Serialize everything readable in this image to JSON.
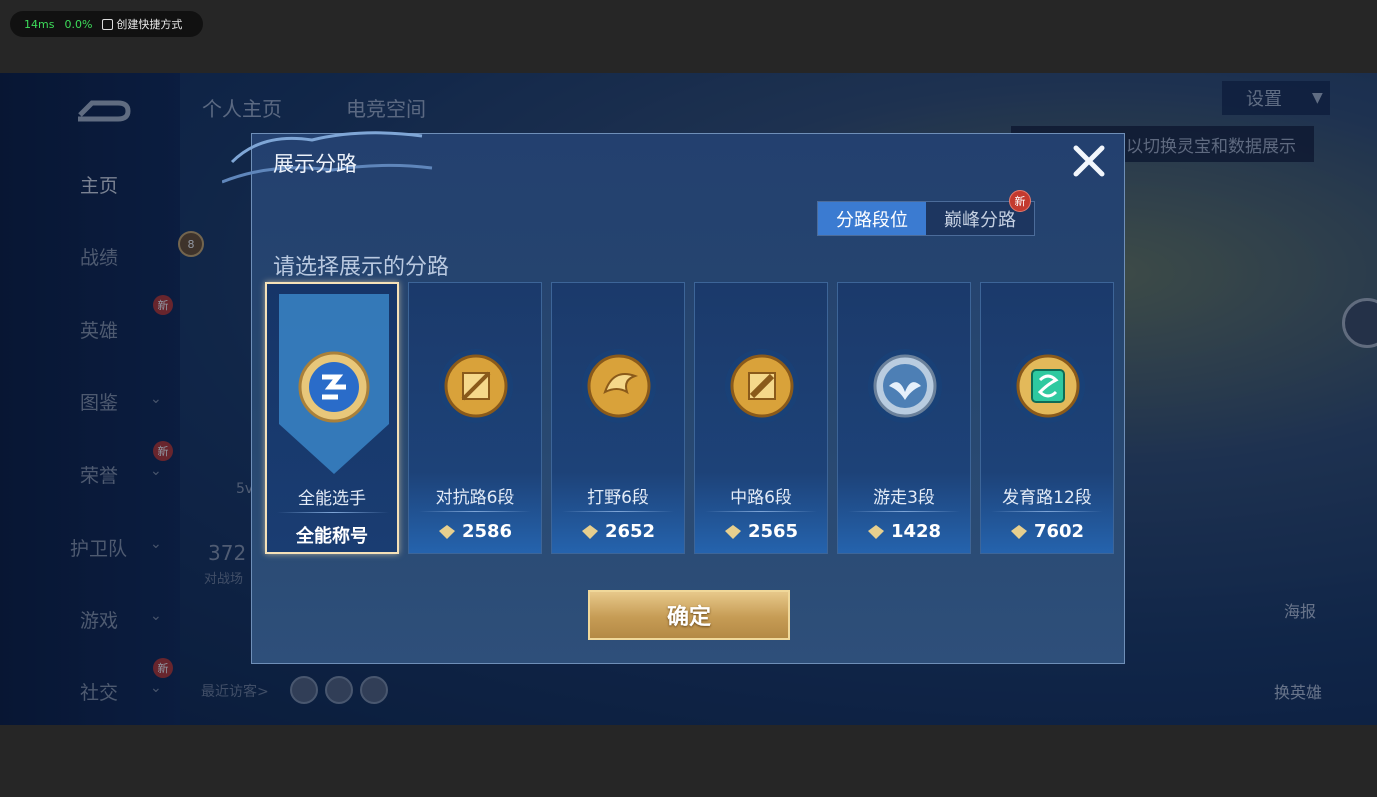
{
  "perf": {
    "ms": "14ms",
    "pct": "0.0%",
    "shortcut": "创建快捷方式"
  },
  "background": {
    "tabs": [
      "个人主页",
      "电竞空间"
    ],
    "sidebar": [
      {
        "label": "主页",
        "active": true
      },
      {
        "label": "战绩"
      },
      {
        "label": "英雄"
      },
      {
        "label": "图鉴"
      },
      {
        "label": "荣誉"
      },
      {
        "label": "护卫队"
      },
      {
        "label": "游戏"
      },
      {
        "label": "社交"
      }
    ],
    "new_badge": "新",
    "settings": "设置",
    "hint": "以切换灵宝和数据展示",
    "right_labels": [
      "海报",
      "换英雄"
    ],
    "visitors": "最近访客>",
    "stat_value": "372",
    "stat_label": "对战场",
    "level_badge": "8",
    "fivev": "5v"
  },
  "modal": {
    "title": "展示分路",
    "segments": [
      {
        "label": "分路段位",
        "active": true
      },
      {
        "label": "巅峰分路",
        "new": "新"
      }
    ],
    "subtitle": "请选择展示的分路",
    "cards": [
      {
        "rank": "全能选手",
        "score": "全能称号",
        "selected": true,
        "emblem": "allround-emblem-icon",
        "color": "#3a7fd6"
      },
      {
        "rank": "对抗路6段",
        "score": "2586",
        "emblem": "clash-lane-icon",
        "color": "#d9a23a"
      },
      {
        "rank": "打野6段",
        "score": "2652",
        "emblem": "jungle-icon",
        "color": "#d9a23a"
      },
      {
        "rank": "中路6段",
        "score": "2565",
        "emblem": "mid-lane-icon",
        "color": "#d9a23a"
      },
      {
        "rank": "游走3段",
        "score": "1428",
        "emblem": "roam-icon",
        "color": "#9fb6cf"
      },
      {
        "rank": "发育路12段",
        "score": "7602",
        "emblem": "farm-lane-icon",
        "color": "#2fc9a0"
      }
    ],
    "confirm": "确定"
  }
}
